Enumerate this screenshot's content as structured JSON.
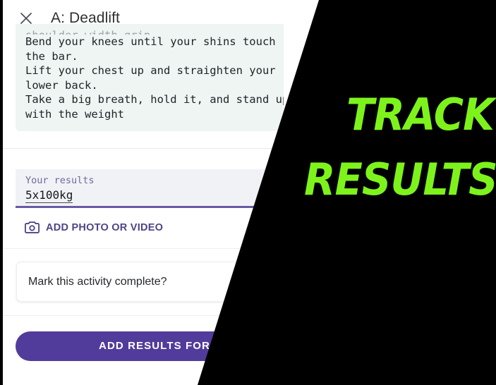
{
  "header": {
    "close_icon": "close-icon",
    "title": "A: Deadlift"
  },
  "instructions": {
    "clipped_line": "shoulder width grip.",
    "lines": [
      "Bend your knees until your shins touch",
      "the bar.",
      "Lift your chest up and straighten your",
      "lower back.",
      "Take a big breath, hold it, and stand up",
      "with the weight"
    ]
  },
  "results_field": {
    "label": "Your results",
    "value": "5x100kg",
    "underline_color": "#6a5aa5"
  },
  "add_photo": {
    "icon": "camera-icon",
    "label": "ADD PHOTO OR VIDEO",
    "color": "#4d4585"
  },
  "complete_card": {
    "label": "Mark this activity complete?"
  },
  "primary_button": {
    "label": "ADD RESULTS FOR",
    "color": "#513c9b"
  },
  "promo": {
    "line1": "TRACK",
    "line2": "RESULTS",
    "text_color": "#7df31b",
    "background_color": "#000000"
  }
}
